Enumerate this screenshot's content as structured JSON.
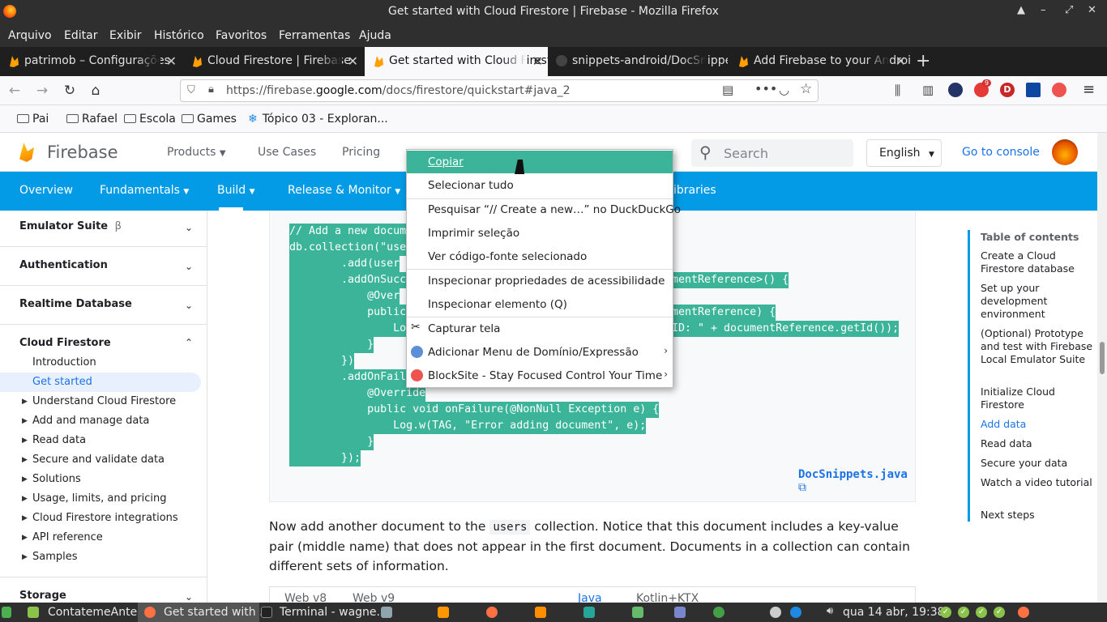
{
  "window": {
    "title": "Get started with Cloud Firestore  |  Firebase - Mozilla Firefox",
    "controls": [
      "▲",
      "–",
      "⤢",
      "✕"
    ]
  },
  "menubar": [
    "Arquivo",
    "Editar",
    "Exibir",
    "Histórico",
    "Favoritos",
    "Ferramentas",
    "Ajuda"
  ],
  "tabs": [
    {
      "label": "patrimob – Configurações",
      "icon": "firebase-icon",
      "active": false
    },
    {
      "label": "Cloud Firestore  |  Firebase",
      "icon": "firebase-icon",
      "active": false
    },
    {
      "label": "Get started with Cloud Firestore",
      "icon": "firebase-icon",
      "active": true
    },
    {
      "label": "snippets-android/DocSnippets",
      "icon": "github-icon",
      "active": false
    },
    {
      "label": "Add Firebase to your Android",
      "icon": "firebase-icon",
      "active": false
    }
  ],
  "newtab": "+",
  "url": {
    "prefix": "https://firebase.",
    "domain": "google.com",
    "path": "/docs/firestore/quickstart#java_2"
  },
  "extension_badge": "9",
  "bookmarks": [
    "Pai",
    "Rafael",
    "Escola",
    "Games",
    "Tópico 03 - Exploran..."
  ],
  "firebase": {
    "brand": "Firebase",
    "nav": [
      "Products",
      "Use Cases",
      "Pricing"
    ],
    "search_placeholder": "Search",
    "language": "English",
    "console": "Go to console",
    "subnav": [
      "Overview",
      "Fundamentals",
      "Build",
      "Release & Monitor",
      "ibraries"
    ]
  },
  "sidebar": {
    "sections": [
      "Emulator Suite",
      "Authentication",
      "Realtime Database",
      "Cloud Firestore",
      "Storage"
    ],
    "beta_mark": "β",
    "firestore_items": [
      "Introduction",
      "Get started"
    ],
    "expandable": [
      "Understand Cloud Firestore",
      "Add and manage data",
      "Read data",
      "Secure and validate data",
      "Solutions",
      "Usage, limits, and pricing",
      "Cloud Firestore integrations",
      "API reference",
      "Samples"
    ]
  },
  "code": [
    "// Add a new docum",
    "db.collection(\"use",
    "        .add(user",
    "        .addOnSucc",
    "            @Over",
    "            public",
    "                Lo",
    "            }",
    "        })",
    "        .addOnFail",
    "            @Override",
    "            public void onFailure(@NonNull Exception e) {",
    "                Log.w(TAG, \"Error adding document\", e);",
    "            }",
    "        });"
  ],
  "code_right": [
    {
      "line": 3,
      "text": "mentReference>() {"
    },
    {
      "line": 5,
      "text": "mentReference) {"
    },
    {
      "line": 6,
      "text": "ID: \" + documentReference.getId());"
    }
  ],
  "docsnippets": "DocSnippets.java",
  "paragraph": {
    "before": "Now add another document to the ",
    "code": "users",
    "after": " collection. Notice that this document includes a key-value pair (middle name) that does not appear in the first document. Documents in a collection can contain different sets of information."
  },
  "code_tabs": [
    "Web v8",
    "Web v9",
    "Java",
    "Kotlin+KTX"
  ],
  "toc": {
    "heading": "Table of contents",
    "items": [
      "Create a Cloud Firestore database",
      "Set up your development environment",
      "(Optional) Prototype and test with Firebase Local Emulator Suite",
      "Initialize Cloud Firestore",
      "Add data",
      "Read data",
      "Secure your data",
      "Watch a video tutorial",
      "Next steps"
    ],
    "active": "Add data"
  },
  "context_menu": [
    {
      "label": "Copiar",
      "accel": "C"
    },
    {
      "label": "Selecionar tudo",
      "accel": "S"
    },
    {
      "label": "Pesquisar “// Create a new…” no DuckDuckGo",
      "accel": "P"
    },
    {
      "label": "Imprimir seleção",
      "accel": "r"
    },
    {
      "label": "Ver código-fonte selecionado",
      "accel": "e"
    },
    {
      "label": "Inspecionar propriedades de acessibilidade"
    },
    {
      "label": "Inspecionar elemento (Q)"
    },
    {
      "label": "Capturar tela"
    },
    {
      "label": "Adicionar Menu de Domínio/Expressão",
      "submenu": true
    },
    {
      "label": "BlockSite - Stay Focused  Control Your Time",
      "submenu": true
    }
  ],
  "taskbar": {
    "items": [
      "ContatemeAnte...",
      "Get started with ...",
      "Terminal - wagne..."
    ],
    "clock": "qua 14 abr, 19:38"
  },
  "colors": {
    "firebase_blue": "#039be5",
    "selection": "#3cb49a",
    "link": "#1a73e8"
  }
}
